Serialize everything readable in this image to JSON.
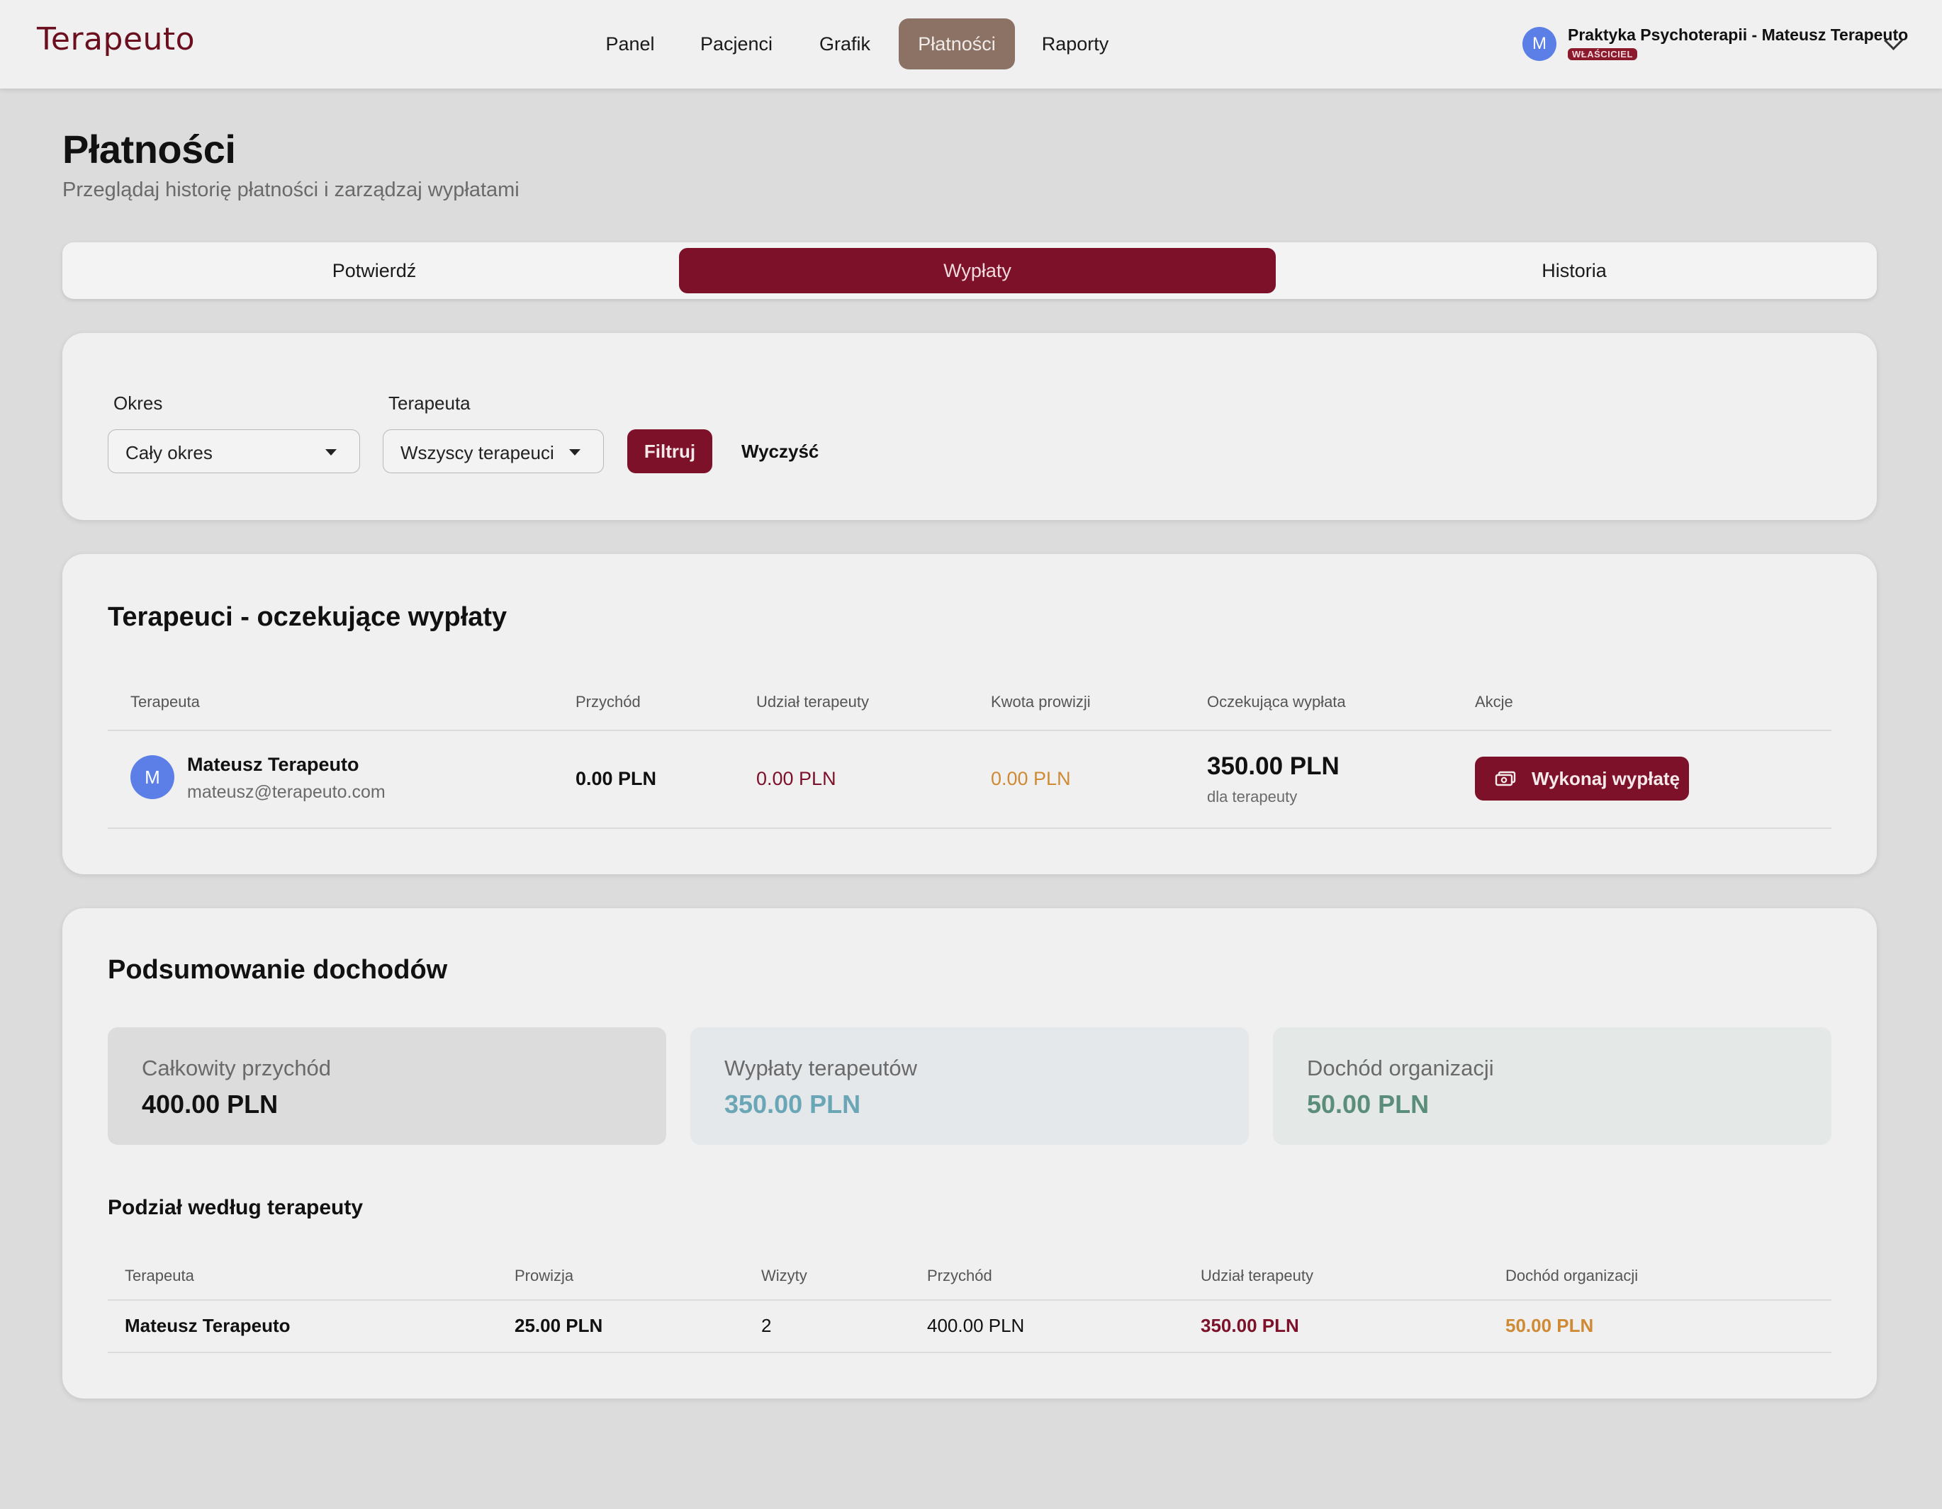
{
  "app": {
    "brand": "Terapeuto",
    "nav": [
      "Panel",
      "Pacjenci",
      "Grafik",
      "Płatności",
      "Raporty"
    ],
    "active_nav": "Płatności",
    "account": {
      "avatar_letter": "M",
      "name": "Praktyka Psychoterapii - Mateusz Terapeuto",
      "role_badge": "WŁAŚCICIEL"
    }
  },
  "page": {
    "title": "Płatności",
    "subtitle": "Przeglądaj historię płatności i zarządzaj wypłatami"
  },
  "tabs": [
    "Potwierdź",
    "Wypłaty",
    "Historia"
  ],
  "active_tab": "Wypłaty",
  "filters": {
    "period_label": "Okres",
    "period_value": "Cały okres",
    "therapist_label": "Terapeuta",
    "therapist_value": "Wszyscy terapeuci",
    "filter_button": "Filtruj",
    "clear_button": "Wyczyść"
  },
  "pending": {
    "title": "Terapeuci - oczekujące wypłaty",
    "columns": [
      "Terapeuta",
      "Przychód",
      "Udział terapeuty",
      "Kwota prowizji",
      "Oczekująca wypłata",
      "Akcje"
    ],
    "rows": [
      {
        "avatar_letter": "M",
        "name": "Mateusz Terapeuto",
        "email": "mateusz@terapeuto.com",
        "revenue": "0.00 PLN",
        "therapist_share": "0.00 PLN",
        "commission": "0.00 PLN",
        "pending_payout": "350.00 PLN",
        "pending_note": "dla terapeuty",
        "action": "Wykonaj wypłatę"
      }
    ]
  },
  "summary": {
    "title": "Podsumowanie dochodów",
    "total_revenue_label": "Całkowity przychód",
    "total_revenue": "400.00 PLN",
    "payouts_label": "Wypłaty terapeutów",
    "payouts": "350.00 PLN",
    "org_income_label": "Dochód organizacji",
    "org_income": "50.00 PLN",
    "breakdown_title": "Podział według terapeuty",
    "columns": [
      "Terapeuta",
      "Prowizja",
      "Wizyty",
      "Przychód",
      "Udział terapeuty",
      "Dochód organizacji"
    ],
    "rows": [
      {
        "therapist": "Mateusz Terapeuto",
        "commission": "25.00 PLN",
        "visits": "2",
        "revenue": "400.00 PLN",
        "therapist_share": "350.00 PLN",
        "org_income": "50.00 PLN"
      }
    ]
  },
  "colors": {
    "brand": "#6b0f1f",
    "accent": "#7d1129",
    "nav_active": "#8b7265",
    "commission_orange": "#d08a34",
    "payout_blue": "#6aa6b5",
    "org_green": "#5a8e7a"
  },
  "icons": {
    "payout_button": "cash-icon",
    "account_menu": "chevron-down-icon"
  }
}
